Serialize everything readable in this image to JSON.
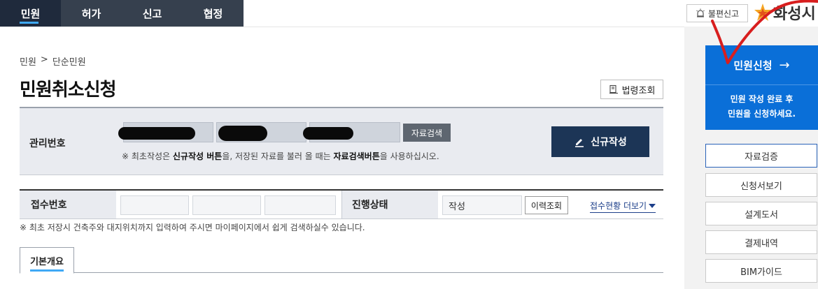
{
  "nav": {
    "tabs": [
      {
        "label": "민원"
      },
      {
        "label": "허가"
      },
      {
        "label": "신고"
      },
      {
        "label": "협정"
      }
    ]
  },
  "header": {
    "complaint_label": "불편신고",
    "logo_text": "화성시"
  },
  "breadcrumb": {
    "root": "민원",
    "sep": ">",
    "current": "단순민원"
  },
  "page": {
    "title": "민원취소신청",
    "law_button": "법령조회"
  },
  "management": {
    "label": "관리번호",
    "search_button": "자료검색",
    "new_button": "신규작성",
    "note": {
      "p1": "※ 최초작성은 ",
      "b1": "신규작성 버튼",
      "p2": "을, 저장된 자료를 불러 올 때는 ",
      "b2": "자료검색버튼",
      "p3": "을 사용하십시오."
    }
  },
  "receipt": {
    "label": "접수번호",
    "status_label": "진행상태",
    "status_value": "작성",
    "history_button": "이력조회",
    "more_link": "접수현황 더보기",
    "note": "※ 최초 저장시 건축주와 대지위치까지 입력하여 주시면 마이페이지에서 쉽게 검색하실수 있습니다."
  },
  "tabs": {
    "basic": "기본개요"
  },
  "sidebar": {
    "apply_title": "민원신청",
    "apply_arrow": "→",
    "apply_line1": "민원 작성 완료 후",
    "apply_line2": "민원을 신청하세요.",
    "buttons": [
      {
        "label": "자료검증"
      },
      {
        "label": "신청서보기"
      },
      {
        "label": "설계도서"
      },
      {
        "label": "결제내역"
      },
      {
        "label": "BIM가이드"
      }
    ]
  },
  "colors": {
    "nav_bg": "#36404e",
    "primary_blue": "#0a6fd8",
    "dark_button": "#1c3556",
    "accent_underline": "#3fa9f5",
    "annotation_red": "#d81e1e"
  }
}
